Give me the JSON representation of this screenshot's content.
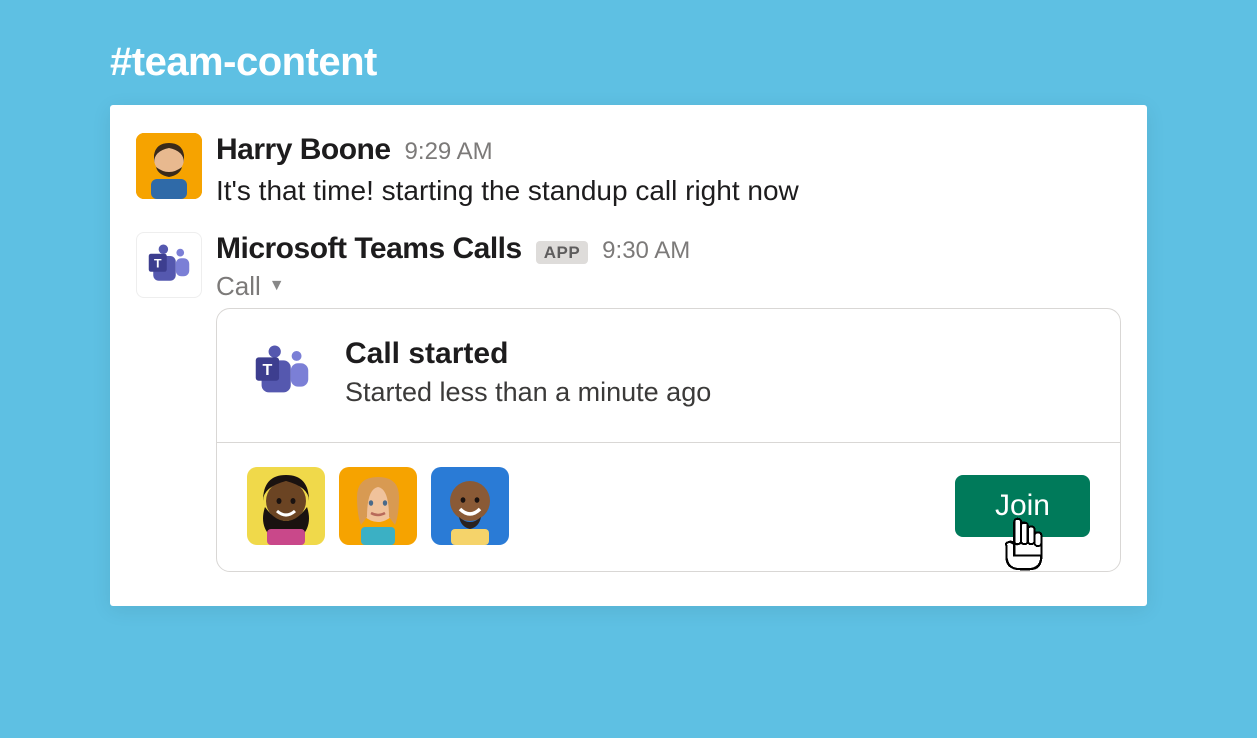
{
  "channel_name": "#team-content",
  "messages": [
    {
      "sender": "Harry Boone",
      "timestamp": "9:29 AM",
      "text": "It's that time! starting the standup call right now"
    },
    {
      "sender": "Microsoft Teams Calls",
      "app_badge": "APP",
      "timestamp": "9:30 AM",
      "menu_label": "Call"
    }
  ],
  "call_card": {
    "title": "Call started",
    "subtitle": "Started less than a minute ago",
    "join_label": "Join",
    "participant_count": 3
  },
  "colors": {
    "background": "#5ec0e3",
    "join_button": "#007a5a",
    "teams_purple": "#5558af"
  }
}
